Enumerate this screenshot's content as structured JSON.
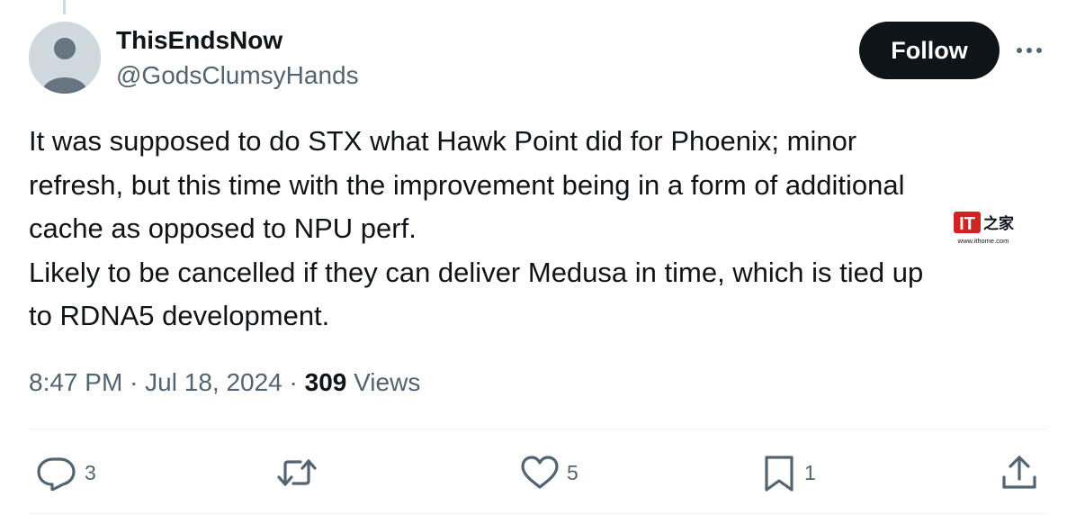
{
  "author": {
    "display_name": "ThisEndsNow",
    "handle": "@GodsClumsyHands"
  },
  "follow_label": "Follow",
  "tweet": {
    "lines": [
      "It was supposed to do STX what Hawk Point did for Phoenix; minor",
      "refresh, but this time with the improvement being in a form of additional",
      "cache as opposed to NPU perf.",
      "Likely to be cancelled if they can deliver Medusa in time, which is tied up",
      "to RDNA5 development."
    ]
  },
  "meta": {
    "time": "8:47 PM",
    "separator": "·",
    "date": "Jul 18, 2024",
    "views_count": "309",
    "views_label": "Views"
  },
  "actions": {
    "reply_count": "3",
    "retweet_count": "",
    "like_count": "5",
    "bookmark_count": "1"
  },
  "watermark": {
    "brand": "IT之家",
    "url": "www.ithome.com"
  },
  "colors": {
    "text_primary": "#0f1419",
    "text_secondary": "#536471",
    "follow_bg": "#0f1419",
    "divider": "#eff3f4",
    "watermark_red": "#d22222"
  },
  "icons": {
    "reply": "reply-icon",
    "retweet": "retweet-icon",
    "like": "heart-icon",
    "bookmark": "bookmark-icon",
    "share": "share-icon",
    "more": "more-icon",
    "avatar": "default-avatar-icon"
  }
}
